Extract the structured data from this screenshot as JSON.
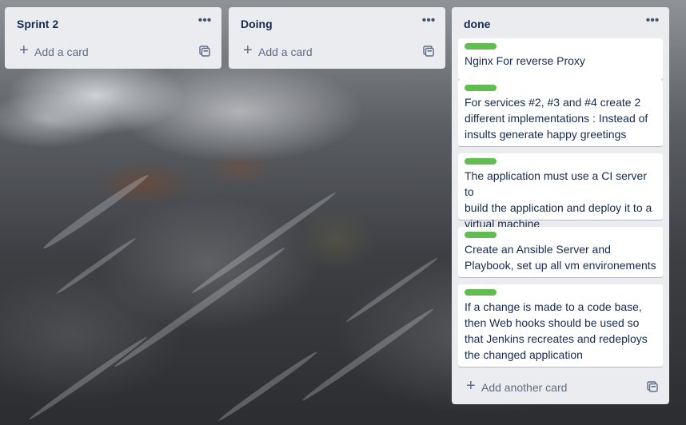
{
  "lists": [
    {
      "title": "Sprint 2",
      "menu_icon": "ellipsis-icon",
      "add_label": "Add a card"
    },
    {
      "title": "Doing",
      "menu_icon": "ellipsis-icon",
      "add_label": "Add a card"
    },
    {
      "title": "done",
      "menu_icon": "ellipsis-icon",
      "add_label": "Add another card",
      "cards": [
        {
          "label_color": "#61bd4f",
          "text": "Nginx For reverse Proxy"
        },
        {
          "label_color": "#61bd4f",
          "text": "For services #2, #3 and #4 create 2\ndifferent implementations : Instead of\ninsults generate happy greetings"
        },
        {
          "label_color": "#61bd4f",
          "text": "The application must use a CI server to\nbuild the application and deploy it to a\nvirtual machine"
        },
        {
          "label_color": "#61bd4f",
          "text": "Create an Ansible Server and\nPlaybook, set up all vm environements"
        },
        {
          "label_color": "#61bd4f",
          "text": "If a change is made to a code base,\nthen Web hooks should be used so\nthat Jenkins recreates and redeploys\nthe changed application"
        }
      ]
    }
  ],
  "icons": {
    "add": "plus-icon",
    "template": "card-template-icon"
  }
}
